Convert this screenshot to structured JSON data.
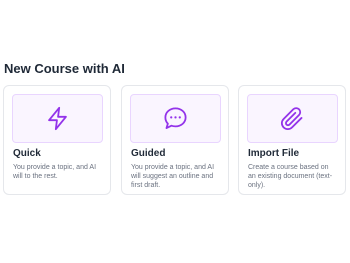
{
  "page": {
    "title": "New Course with AI"
  },
  "colors": {
    "accent": "#9333ea",
    "icon_bg": "#faf5ff",
    "icon_border": "#e9d5ff",
    "card_border": "#e5e7eb"
  },
  "cards": [
    {
      "title": "Quick",
      "description": "You provide a topic, and AI will to the rest.",
      "icon": "lightning-icon"
    },
    {
      "title": "Guided",
      "description": "You provide a topic, and AI will suggest an outline and first draft.",
      "icon": "chat-bubble-icon"
    },
    {
      "title": "Import File",
      "description": "Create a course based on an existing document (text-only).",
      "icon": "paperclip-icon"
    }
  ]
}
